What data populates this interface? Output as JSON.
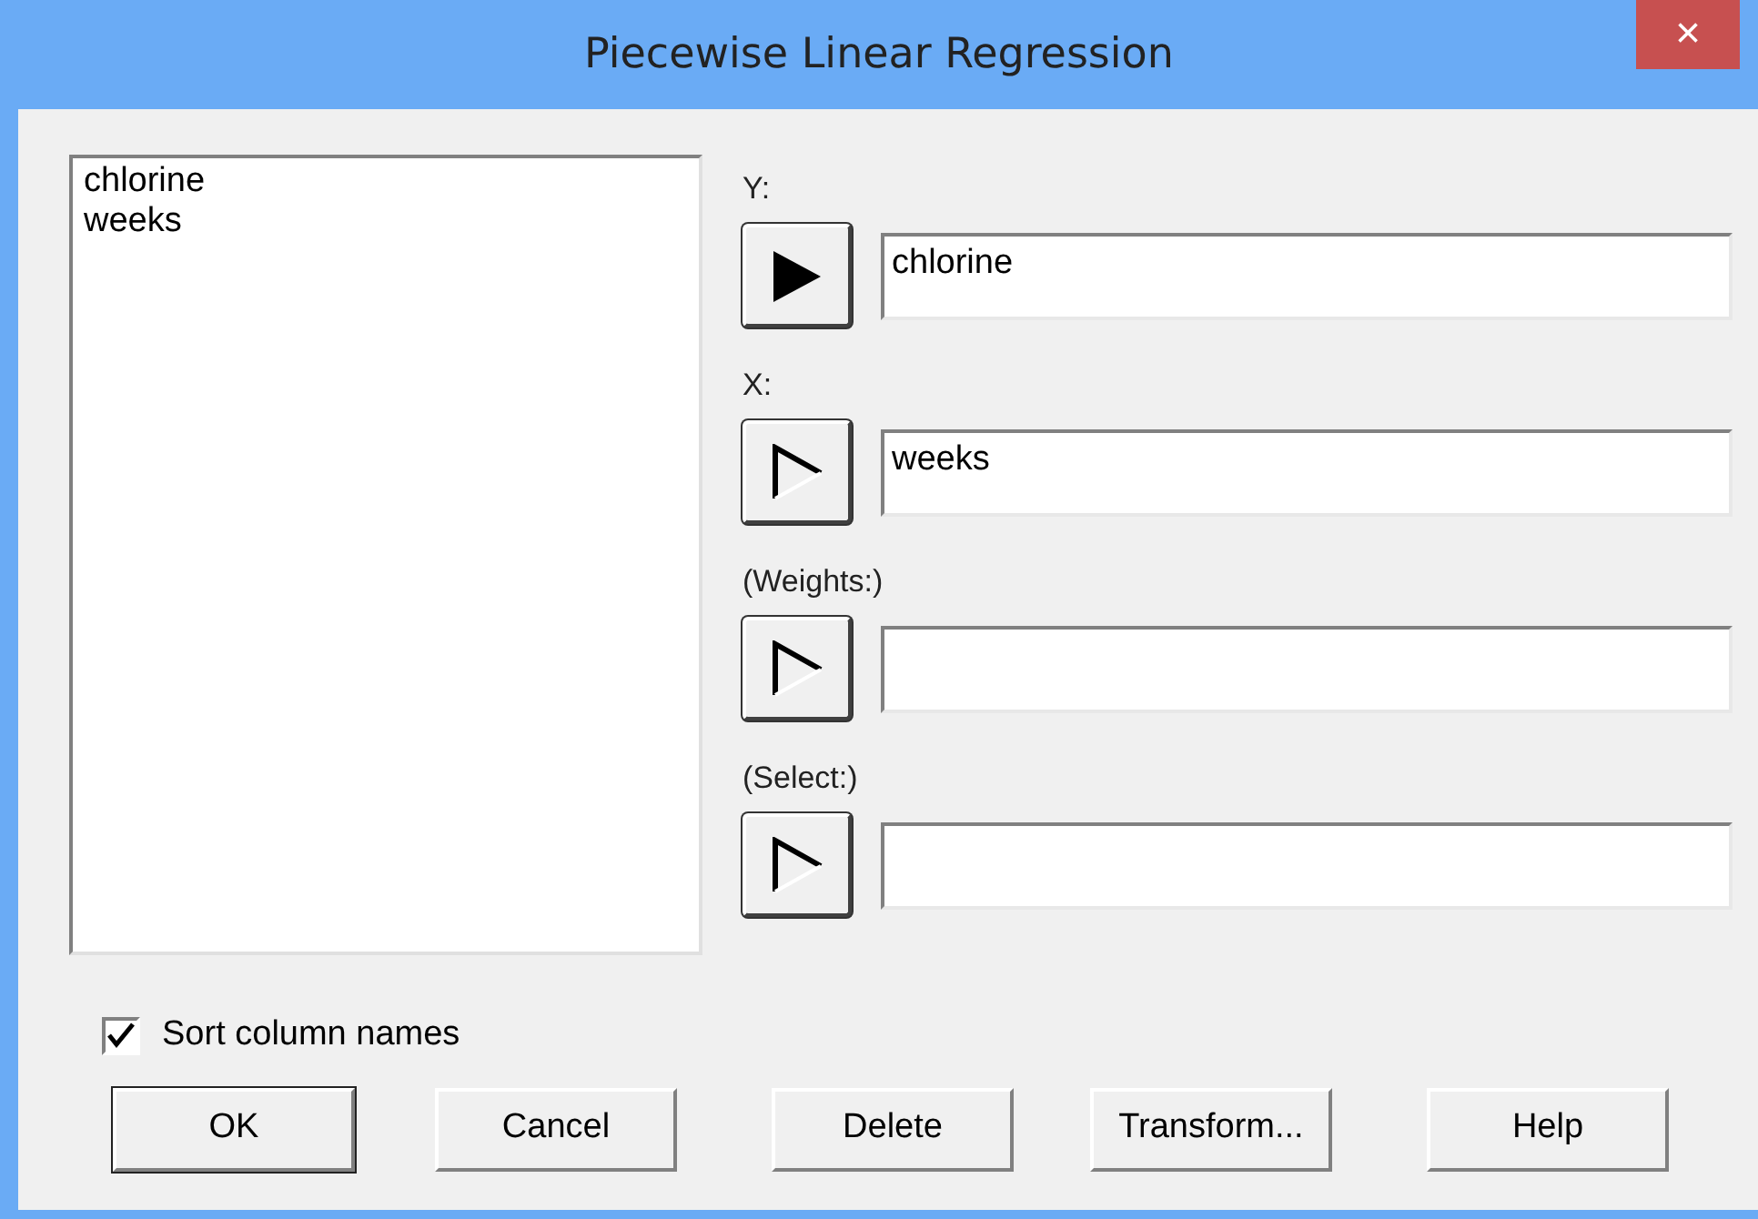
{
  "window": {
    "title": "Piecewise Linear Regression",
    "close": "×"
  },
  "column_list": [
    "chlorine",
    "weeks"
  ],
  "variables": [
    {
      "label": "Y:",
      "value": "chlorine",
      "active": true
    },
    {
      "label": "X:",
      "value": "weeks",
      "active": false
    },
    {
      "label": "(Weights:)",
      "active": false
    },
    {
      "label": "(Select:)",
      "active": false
    }
  ],
  "sort_column_names": {
    "label": "Sort column names",
    "checked": true
  },
  "buttons": [
    {
      "label": "OK",
      "default": true
    },
    {
      "label": "Cancel",
      "default": false
    },
    {
      "label": "Delete",
      "default": false
    },
    {
      "label": "Transform...",
      "default": false
    },
    {
      "label": "Help",
      "default": false
    }
  ]
}
